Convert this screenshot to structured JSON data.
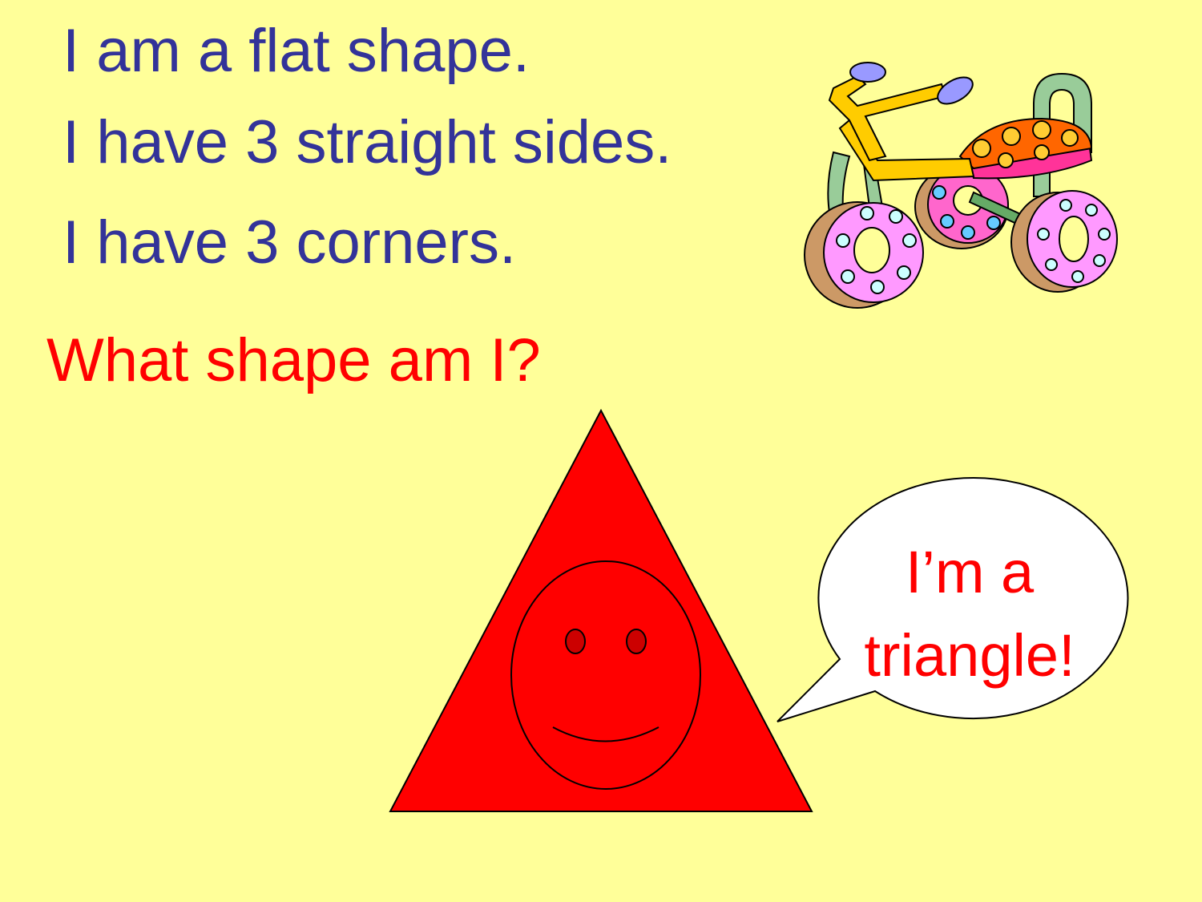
{
  "clues": [
    "I am a flat shape.",
    "I have 3 straight sides.",
    "I have 3 corners."
  ],
  "question": "What shape am I?",
  "speech_bubble": {
    "line1": "I’m a",
    "line2": "triangle!"
  },
  "colors": {
    "background": "#FFFF99",
    "clue_text": "#333399",
    "question_text": "#FF0000",
    "triangle_fill": "#FF0000",
    "bubble_fill": "#FFFFFF"
  },
  "icons": {
    "character": "smiling-triangle-icon",
    "clipart": "tricycle-icon"
  }
}
